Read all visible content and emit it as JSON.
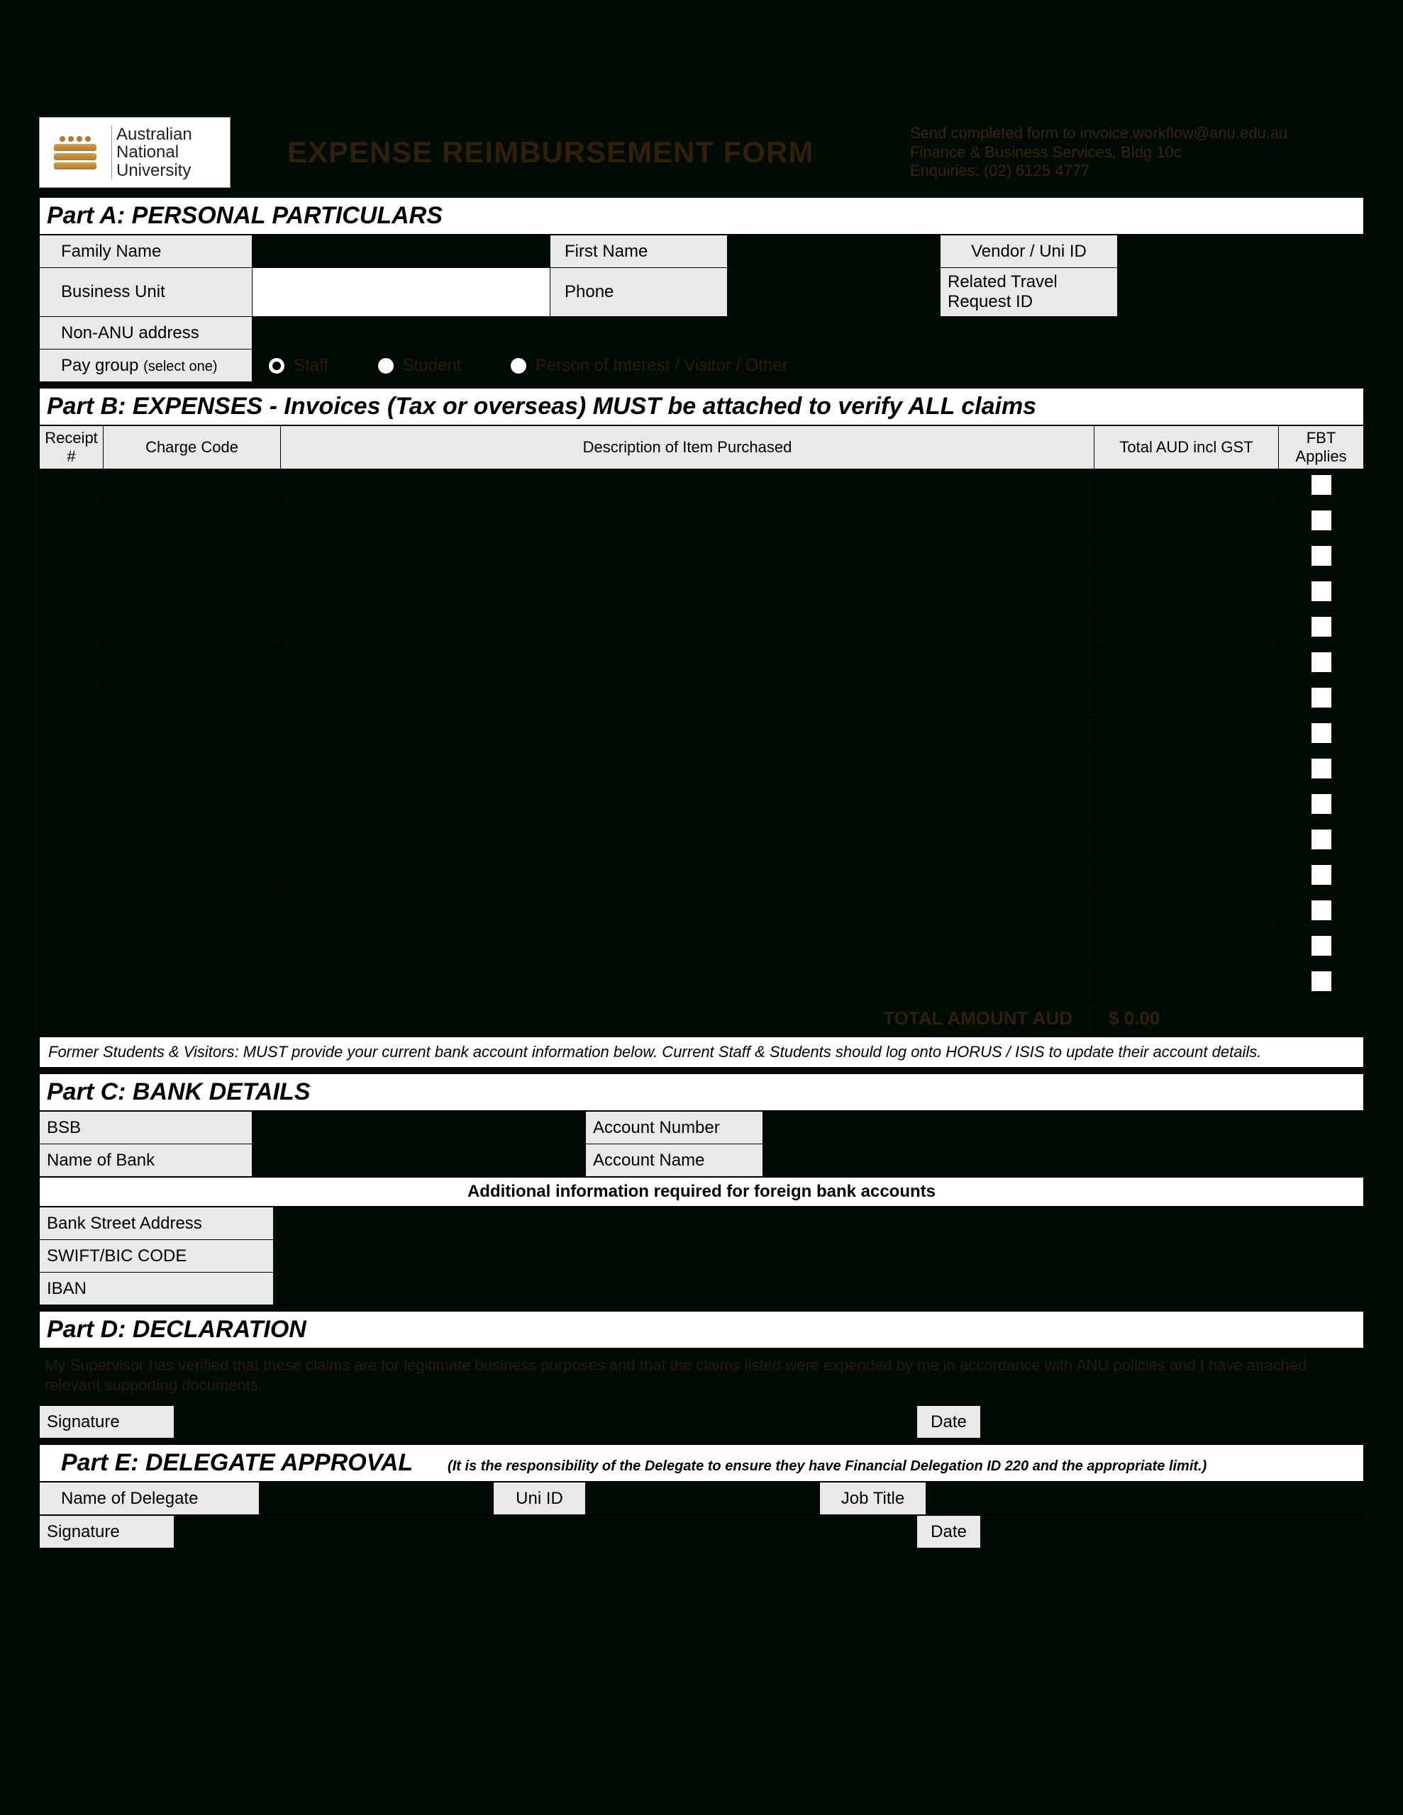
{
  "logo": {
    "line1": "Australian",
    "line2": "National",
    "line3": "University"
  },
  "title": "EXPENSE REIMBURSEMENT FORM",
  "send": {
    "line1": "Send completed form to invoice.workflow@anu.edu.au",
    "line2": "Finance & Business Services, Bldg 10c",
    "line3": "Enquiries: (02) 6125 4777"
  },
  "partA": {
    "header": "Part A: PERSONAL PARTICULARS",
    "labels": {
      "family": "Family Name",
      "first": "First Name",
      "vendor": "Vendor  /  Uni ID",
      "bu": "Business Unit",
      "phone": "Phone",
      "travel": "Related Travel Request ID",
      "addr": "Non-ANU address",
      "paygroup": "Pay group",
      "paygroup_hint": "(select one)"
    },
    "options": {
      "staff": "Staff",
      "student": "Student",
      "other": "Person of Interest / Visitor / Other"
    }
  },
  "partB": {
    "header": "Part B: EXPENSES - Invoices (Tax or overseas) MUST be attached to verify ALL claims",
    "cols": {
      "receipt": "Receipt #",
      "code": "Charge Code",
      "desc": "Description of Item Purchased",
      "total": "Total AUD incl GST",
      "fbt": "FBT Applies"
    },
    "rows": 15,
    "total_label": "TOTAL AMOUNT AUD",
    "total_value": "$ 0.00",
    "note": "Former Students & Visitors: MUST provide your current bank account information below. Current Staff & Students should log onto HORUS / ISIS to update their account details."
  },
  "partC": {
    "header": "Part C: BANK DETAILS",
    "bsb": "BSB",
    "accnum": "Account Number",
    "bankname": "Name of Bank",
    "accname": "Account Name",
    "foreign_hdr": "Additional information required for foreign bank accounts",
    "street": "Bank Street Address",
    "swift": "SWIFT/BIC CODE",
    "iban": "IBAN"
  },
  "partD": {
    "header": "Part D: DECLARATION",
    "text": "My Supervisor has verified that these claims are for legitimate business purposes and that the claims listed were expended by me in accordance with ANU policies and I have attached relevant supporting documents.",
    "sig": "Signature",
    "date": "Date"
  },
  "partE": {
    "header": "Part E: DELEGATE APPROVAL",
    "sub": "(It is the responsibility of the Delegate to ensure they have Financial Delegation ID 220 and the appropriate limit.)",
    "name": "Name of Delegate",
    "uni": "Uni ID",
    "job": "Job Title",
    "sig": "Signature",
    "date": "Date"
  }
}
